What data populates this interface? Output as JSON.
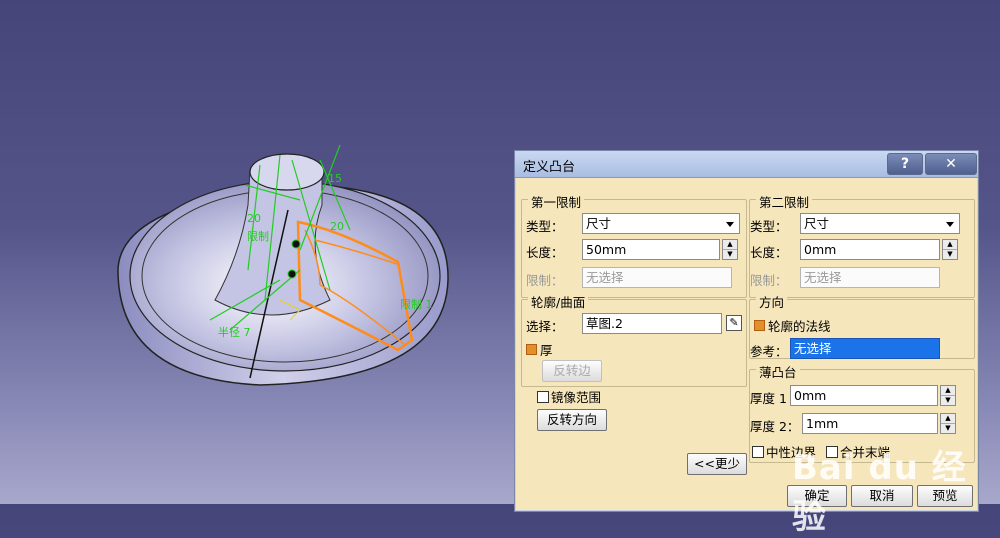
{
  "dialog": {
    "title": "定义凸台",
    "help_label": "?",
    "close_label": "✕",
    "first_limit": {
      "title": "第一限制",
      "type_label": "类型：",
      "type_value": "尺寸",
      "length_label": "长度：",
      "length_value": "50mm",
      "limit_label": "限制：",
      "limit_value": "无选择"
    },
    "second_limit": {
      "title": "第二限制",
      "type_label": "类型：",
      "type_value": "尺寸",
      "length_label": "长度：",
      "length_value": "0mm",
      "limit_label": "限制：",
      "limit_value": "无选择"
    },
    "profile": {
      "title": "轮廓/曲面",
      "select_label": "选择：",
      "select_value": "草图.2",
      "thick_label": "厚",
      "thick_checked": true,
      "reverse_side_label": "反转边"
    },
    "mirror_label": "镜像范围",
    "mirror_checked": false,
    "reverse_direction_label": "反转方向",
    "less_label": "<<更少",
    "direction": {
      "title": "方向",
      "normal_label": "轮廓的法线",
      "normal_checked": true,
      "ref_label": "参考：",
      "ref_value": "无选择"
    },
    "thin_pad": {
      "title": "薄凸台",
      "thickness1_label": "厚度 1",
      "thickness1_value": "0mm",
      "thickness2_label": "厚度 2：",
      "thickness2_value": "1mm",
      "neutral_label": "中性边界",
      "neutral_checked": false,
      "merge_label": "合并末端",
      "merge_checked": false
    },
    "ok_label": "确定",
    "cancel_label": "取消",
    "preview_label": "预览"
  },
  "model": {
    "tags": [
      "20",
      "限制",
      "半径 7",
      "限制 1",
      "15",
      "20"
    ]
  },
  "watermark": "Bai du 经验",
  "colors": {
    "background_top": "#45457a",
    "dialog_bg": "#f6e6bc",
    "sketch_green": "#22cc22",
    "preview_orange": "#ff8c1a",
    "selection_blue": "#1a73e8"
  }
}
